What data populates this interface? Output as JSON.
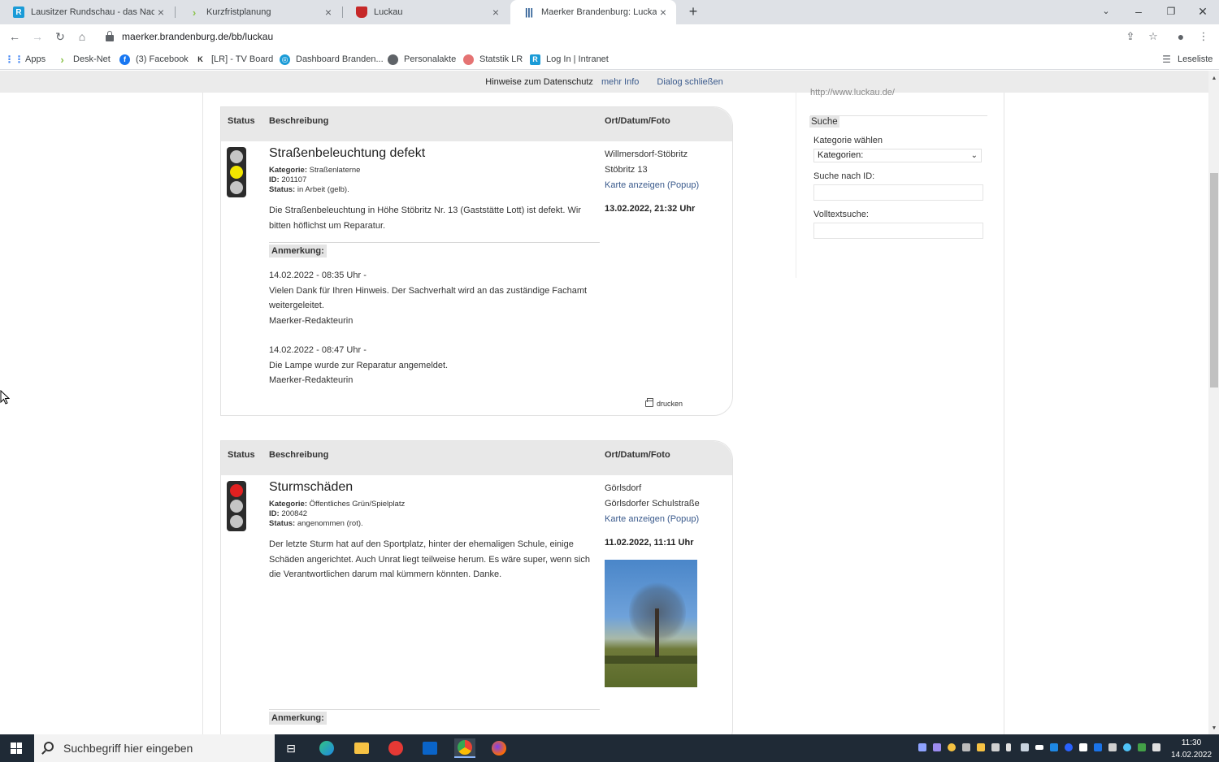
{
  "browser": {
    "tabs": [
      {
        "title": "Lausitzer Rundschau - das Nachr",
        "icon": "lr-icon"
      },
      {
        "title": "Kurzfristplanung",
        "icon": "chevron-right-icon"
      },
      {
        "title": "Luckau",
        "icon": "coat-of-arms-icon"
      },
      {
        "title": "Maerker Brandenburg: Luckau",
        "icon": "maerker-icon"
      }
    ],
    "url": "maerker.brandenburg.de/bb/luckau",
    "bookmarks": [
      {
        "label": "Apps"
      },
      {
        "label": "Desk-Net"
      },
      {
        "label": "(3) Facebook"
      },
      {
        "label": "[LR] - TV Board"
      },
      {
        "label": "Dashboard Branden..."
      },
      {
        "label": "Personalakte"
      },
      {
        "label": "Statstik LR"
      },
      {
        "label": "Log In | Intranet"
      }
    ],
    "reading_list": "Leseliste"
  },
  "cookiebar": {
    "text": "Hinweise zum Datenschutz",
    "more": "mehr Info",
    "close": "Dialog schließen"
  },
  "headers": {
    "status": "Status",
    "description": "Beschreibung",
    "location": "Ort/Datum/Foto"
  },
  "reports": [
    {
      "title": "Straßenbeleuchtung defekt",
      "category_label": "Kategorie:",
      "category": "Straßenlaterne",
      "id_label": "ID:",
      "id": "201107",
      "status_label": "Status:",
      "status": "in Arbeit (gelb).",
      "status_color": "yellow",
      "description": "Die Straßenbeleuchtung in Höhe Stöbritz Nr. 13 (Gaststätte Lott) ist defekt. Wir bitten höflichst um Reparatur.",
      "remark_label": "Anmerkung:",
      "notes": [
        {
          "date": "14.02.2022 - 08:35 Uhr -",
          "text": "Vielen Dank für Ihren Hinweis. Der Sachverhalt wird an das zuständige Fachamt weitergeleitet.",
          "author": "Maerker-Redakteurin"
        },
        {
          "date": "14.02.2022 - 08:47 Uhr -",
          "text": "Die Lampe wurde zur Reparatur angemeldet.",
          "author": "Maerker-Redakteurin"
        }
      ],
      "place": "Willmersdorf-Stöbritz",
      "street": "Stöbritz 13",
      "map_link": "Karte anzeigen (Popup)",
      "date": "13.02.2022, 21:32 Uhr",
      "print": "drucken"
    },
    {
      "title": "Sturmschäden",
      "category_label": "Kategorie:",
      "category": "Öffentliches Grün/Spielplatz",
      "id_label": "ID:",
      "id": "200842",
      "status_label": "Status:",
      "status": "angenommen (rot).",
      "status_color": "red",
      "description": "Der letzte Sturm hat auf den Sportplatz, hinter der ehemaligen Schule, einige Schäden angerichtet. Auch Unrat liegt teilweise herum. Es wäre super, wenn sich die Verantwortlichen darum mal kümmern könnten. Danke.",
      "remark_label": "Anmerkung:",
      "place": "Görlsdorf",
      "street": "Görlsdorfer Schulstraße",
      "map_link": "Karte anzeigen (Popup)",
      "date": "11.02.2022, 11:11 Uhr"
    }
  ],
  "sidebar": {
    "url": "http://www.luckau.de/",
    "search_title": "Suche",
    "category_label": "Kategorie wählen",
    "category_select": "Kategorien:",
    "id_label": "Suche nach ID:",
    "fulltext_label": "Volltextsuche:"
  },
  "taskbar": {
    "search_placeholder": "Suchbegriff hier eingeben",
    "time": "11:30",
    "date": "14.02.2022"
  },
  "colors": {
    "link": "#3a5a8c",
    "light_yellow": "#f2e600",
    "light_red": "#e02020",
    "light_off": "#c5c5c5"
  }
}
